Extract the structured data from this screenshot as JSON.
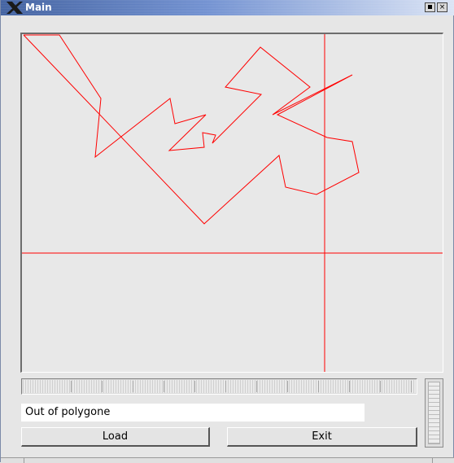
{
  "window": {
    "title": "Main",
    "icon": "x-logo-icon",
    "minimize_icon": "minimize-icon",
    "close_icon": "close-icon",
    "close_glyph": "×"
  },
  "canvas": {
    "line_color": "#ff0000",
    "background": "#e8e8e8"
  },
  "status": {
    "text": "Out of polygone"
  },
  "buttons": {
    "load": "Load",
    "exit": "Exit"
  }
}
